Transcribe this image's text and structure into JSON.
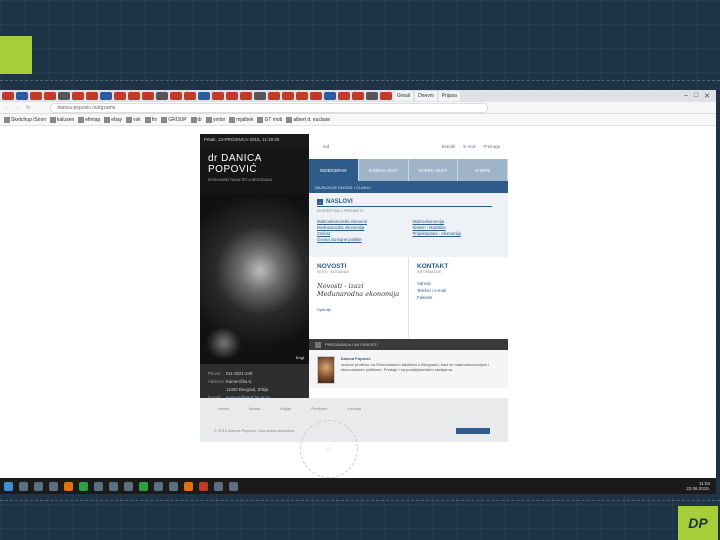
{
  "slide": {
    "logo": "DP"
  },
  "browser": {
    "tabs": [
      "Gmail",
      "Dnevni",
      "Prijava"
    ],
    "url": "danica-popovic.rs/egzams",
    "bookmarks": [
      "Sketchup iSoon",
      "kalusen",
      "efimap",
      "ebay",
      "vsk",
      "fm",
      "GROUP",
      "dr",
      "ymlor",
      "mjalbek",
      "GT mob",
      "albert d. euclase"
    ]
  },
  "site": {
    "date": "Petak, 13-PROSINCA-2015, 11:19:25",
    "name": "dr DANICA POPOVIĆ",
    "subtitle": "EKONOMSKI FAKULTET U BEOGRADU",
    "photo_caption": "Engl.",
    "topbar": {
      "left": "red",
      "icons": [
        "Brandit",
        "E-mail",
        "Pretraga"
      ]
    },
    "nav": [
      "INDEKSIRAN",
      "ZADNJA VEST",
      "DOBRE VESTI",
      "O MENI"
    ],
    "subnav": "NAJNOVIJE KNJIGE I ČLANCI",
    "main": {
      "title": "NASLOVI",
      "subtitle": "EKSPERTIZA U PREDMETU",
      "links": [
        "Makroekonomski elementi",
        "Makroekonomija",
        "Međunarodna ekonomija",
        "Sistem i statistika",
        "Zrelost",
        "Projektovana - ekonomija",
        "Ocena razvojne politike"
      ]
    },
    "news": {
      "title": "NOVOSTI",
      "sub": "VESTI · DOGAĐAJI",
      "handwritten": [
        "Novosti - izazi",
        "Međunarodna ekonomija"
      ],
      "more": "Opširnije"
    },
    "contact": {
      "title": "KONTAKT",
      "sub": "INFORMACIJE",
      "items": [
        "Adresa",
        "Telefon i e-mail",
        "Fakultet"
      ]
    },
    "darkbar": "PREDAVANJA I AKTIVNOSTI",
    "profile": {
      "name": "Danica Popović",
      "text": "redovni profesor na Ekonomskom fakultetu u Beogradu, bavi se makroekonomijom i ekonomskom politikom. Predaje i na postdiplomskim studijama."
    },
    "contact_info": [
      {
        "k": "Phone:",
        "v": "011-3021-240"
      },
      {
        "k": "Address:",
        "v": "Kamenička 6,"
      },
      {
        "k": "",
        "v": "11000 Beograd, Srbija"
      },
      {
        "k": "E-mail:",
        "v": "popovic@ekof.bg.ac.rs"
      }
    ],
    "footer": {
      "links": [
        "Home",
        "Nauka",
        "Knjige",
        "Predmeti",
        "Kontakt"
      ],
      "copy": "© 2015 Danica Popović. Sva prava zadržana."
    }
  },
  "taskbar": {
    "time": "11:04",
    "date": "22.06.2015."
  }
}
